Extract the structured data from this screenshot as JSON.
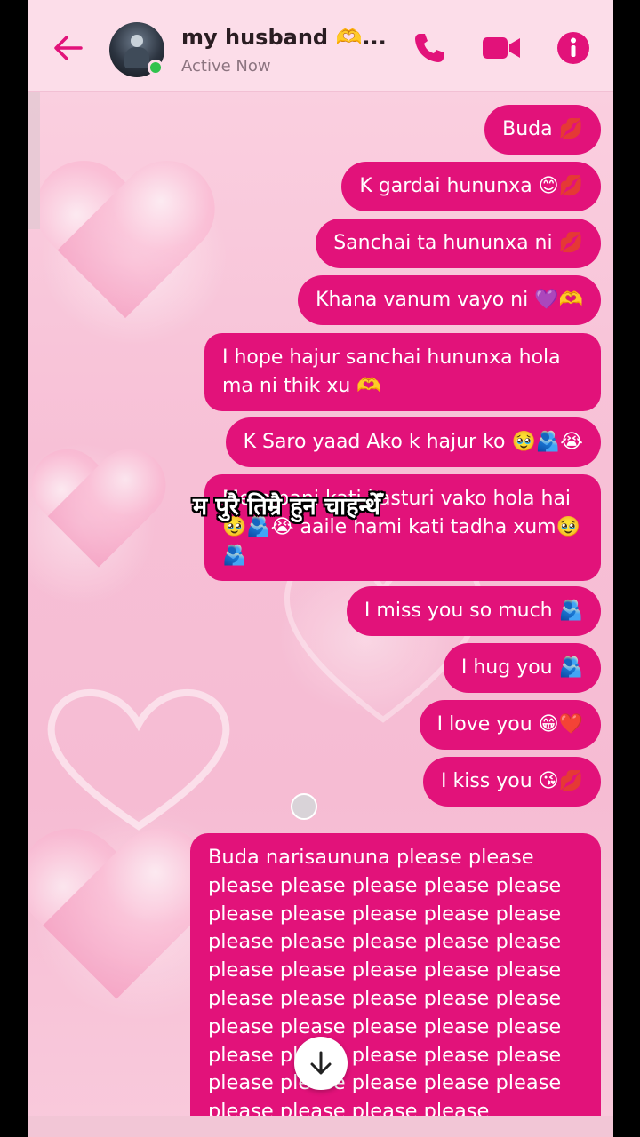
{
  "header": {
    "contact_name": "my husband 🫶...",
    "status": "Active Now"
  },
  "overlay_caption": "म पुरै तिम्रै हुन चाहन्थेँ",
  "messages": [
    {
      "text": "Buda 💋"
    },
    {
      "text": "K gardai hununxa 😊💋"
    },
    {
      "text": "Sanchai ta hununxa ni 💋"
    },
    {
      "text": "Khana vanum vayo ni 💜🫶"
    },
    {
      "text": "I hope hajur sanchai hununxa hola ma ni thik xu 🫶"
    },
    {
      "text": "K Saro yaad Ako k hajur ko 🥹🫂😭"
    },
    {
      "text": "Mero pani kati kasturi vako hola hai 🥹🫂😭 aaile hami kati tadha xum🥹🫂"
    },
    {
      "text": "I miss you so much 🫂"
    },
    {
      "text": "I hug you 🫂"
    },
    {
      "text": "I love you 😁❤️"
    },
    {
      "text": "I kiss you 😘💋"
    }
  ],
  "last_message": "Buda narisaununa please please please please please please please please please please please please please please please please please please please please please please please please please please please please please please please please please please please please please please please please please please please please please please",
  "colors": {
    "bubble": "#e2127a",
    "accent": "#e2127a",
    "online": "#31c24d"
  },
  "icons": [
    "back-arrow-icon",
    "phone-icon",
    "video-camera-icon",
    "info-icon",
    "arrow-down-icon"
  ]
}
